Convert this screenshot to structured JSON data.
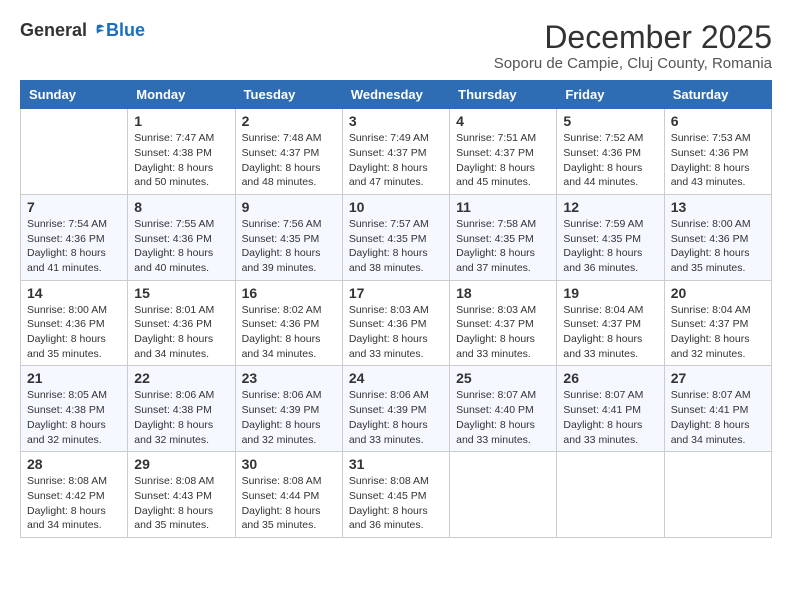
{
  "logo": {
    "general": "General",
    "blue": "Blue"
  },
  "title": "December 2025",
  "subtitle": "Soporu de Campie, Cluj County, Romania",
  "days_of_week": [
    "Sunday",
    "Monday",
    "Tuesday",
    "Wednesday",
    "Thursday",
    "Friday",
    "Saturday"
  ],
  "weeks": [
    [
      {
        "day": "",
        "sunrise": "",
        "sunset": "",
        "daylight": ""
      },
      {
        "day": "1",
        "sunrise": "Sunrise: 7:47 AM",
        "sunset": "Sunset: 4:38 PM",
        "daylight": "Daylight: 8 hours and 50 minutes."
      },
      {
        "day": "2",
        "sunrise": "Sunrise: 7:48 AM",
        "sunset": "Sunset: 4:37 PM",
        "daylight": "Daylight: 8 hours and 48 minutes."
      },
      {
        "day": "3",
        "sunrise": "Sunrise: 7:49 AM",
        "sunset": "Sunset: 4:37 PM",
        "daylight": "Daylight: 8 hours and 47 minutes."
      },
      {
        "day": "4",
        "sunrise": "Sunrise: 7:51 AM",
        "sunset": "Sunset: 4:37 PM",
        "daylight": "Daylight: 8 hours and 45 minutes."
      },
      {
        "day": "5",
        "sunrise": "Sunrise: 7:52 AM",
        "sunset": "Sunset: 4:36 PM",
        "daylight": "Daylight: 8 hours and 44 minutes."
      },
      {
        "day": "6",
        "sunrise": "Sunrise: 7:53 AM",
        "sunset": "Sunset: 4:36 PM",
        "daylight": "Daylight: 8 hours and 43 minutes."
      }
    ],
    [
      {
        "day": "7",
        "sunrise": "Sunrise: 7:54 AM",
        "sunset": "Sunset: 4:36 PM",
        "daylight": "Daylight: 8 hours and 41 minutes."
      },
      {
        "day": "8",
        "sunrise": "Sunrise: 7:55 AM",
        "sunset": "Sunset: 4:36 PM",
        "daylight": "Daylight: 8 hours and 40 minutes."
      },
      {
        "day": "9",
        "sunrise": "Sunrise: 7:56 AM",
        "sunset": "Sunset: 4:35 PM",
        "daylight": "Daylight: 8 hours and 39 minutes."
      },
      {
        "day": "10",
        "sunrise": "Sunrise: 7:57 AM",
        "sunset": "Sunset: 4:35 PM",
        "daylight": "Daylight: 8 hours and 38 minutes."
      },
      {
        "day": "11",
        "sunrise": "Sunrise: 7:58 AM",
        "sunset": "Sunset: 4:35 PM",
        "daylight": "Daylight: 8 hours and 37 minutes."
      },
      {
        "day": "12",
        "sunrise": "Sunrise: 7:59 AM",
        "sunset": "Sunset: 4:35 PM",
        "daylight": "Daylight: 8 hours and 36 minutes."
      },
      {
        "day": "13",
        "sunrise": "Sunrise: 8:00 AM",
        "sunset": "Sunset: 4:36 PM",
        "daylight": "Daylight: 8 hours and 35 minutes."
      }
    ],
    [
      {
        "day": "14",
        "sunrise": "Sunrise: 8:00 AM",
        "sunset": "Sunset: 4:36 PM",
        "daylight": "Daylight: 8 hours and 35 minutes."
      },
      {
        "day": "15",
        "sunrise": "Sunrise: 8:01 AM",
        "sunset": "Sunset: 4:36 PM",
        "daylight": "Daylight: 8 hours and 34 minutes."
      },
      {
        "day": "16",
        "sunrise": "Sunrise: 8:02 AM",
        "sunset": "Sunset: 4:36 PM",
        "daylight": "Daylight: 8 hours and 34 minutes."
      },
      {
        "day": "17",
        "sunrise": "Sunrise: 8:03 AM",
        "sunset": "Sunset: 4:36 PM",
        "daylight": "Daylight: 8 hours and 33 minutes."
      },
      {
        "day": "18",
        "sunrise": "Sunrise: 8:03 AM",
        "sunset": "Sunset: 4:37 PM",
        "daylight": "Daylight: 8 hours and 33 minutes."
      },
      {
        "day": "19",
        "sunrise": "Sunrise: 8:04 AM",
        "sunset": "Sunset: 4:37 PM",
        "daylight": "Daylight: 8 hours and 33 minutes."
      },
      {
        "day": "20",
        "sunrise": "Sunrise: 8:04 AM",
        "sunset": "Sunset: 4:37 PM",
        "daylight": "Daylight: 8 hours and 32 minutes."
      }
    ],
    [
      {
        "day": "21",
        "sunrise": "Sunrise: 8:05 AM",
        "sunset": "Sunset: 4:38 PM",
        "daylight": "Daylight: 8 hours and 32 minutes."
      },
      {
        "day": "22",
        "sunrise": "Sunrise: 8:06 AM",
        "sunset": "Sunset: 4:38 PM",
        "daylight": "Daylight: 8 hours and 32 minutes."
      },
      {
        "day": "23",
        "sunrise": "Sunrise: 8:06 AM",
        "sunset": "Sunset: 4:39 PM",
        "daylight": "Daylight: 8 hours and 32 minutes."
      },
      {
        "day": "24",
        "sunrise": "Sunrise: 8:06 AM",
        "sunset": "Sunset: 4:39 PM",
        "daylight": "Daylight: 8 hours and 33 minutes."
      },
      {
        "day": "25",
        "sunrise": "Sunrise: 8:07 AM",
        "sunset": "Sunset: 4:40 PM",
        "daylight": "Daylight: 8 hours and 33 minutes."
      },
      {
        "day": "26",
        "sunrise": "Sunrise: 8:07 AM",
        "sunset": "Sunset: 4:41 PM",
        "daylight": "Daylight: 8 hours and 33 minutes."
      },
      {
        "day": "27",
        "sunrise": "Sunrise: 8:07 AM",
        "sunset": "Sunset: 4:41 PM",
        "daylight": "Daylight: 8 hours and 34 minutes."
      }
    ],
    [
      {
        "day": "28",
        "sunrise": "Sunrise: 8:08 AM",
        "sunset": "Sunset: 4:42 PM",
        "daylight": "Daylight: 8 hours and 34 minutes."
      },
      {
        "day": "29",
        "sunrise": "Sunrise: 8:08 AM",
        "sunset": "Sunset: 4:43 PM",
        "daylight": "Daylight: 8 hours and 35 minutes."
      },
      {
        "day": "30",
        "sunrise": "Sunrise: 8:08 AM",
        "sunset": "Sunset: 4:44 PM",
        "daylight": "Daylight: 8 hours and 35 minutes."
      },
      {
        "day": "31",
        "sunrise": "Sunrise: 8:08 AM",
        "sunset": "Sunset: 4:45 PM",
        "daylight": "Daylight: 8 hours and 36 minutes."
      },
      {
        "day": "",
        "sunrise": "",
        "sunset": "",
        "daylight": ""
      },
      {
        "day": "",
        "sunrise": "",
        "sunset": "",
        "daylight": ""
      },
      {
        "day": "",
        "sunrise": "",
        "sunset": "",
        "daylight": ""
      }
    ]
  ]
}
